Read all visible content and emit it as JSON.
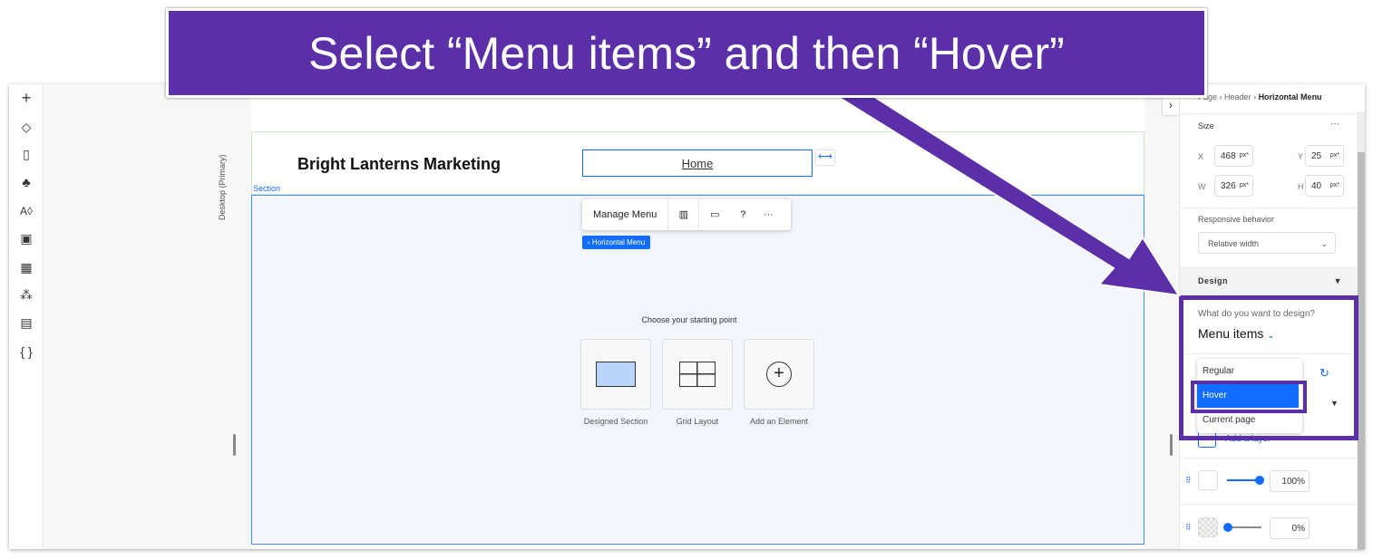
{
  "banner": {
    "text": "Select “Menu items” and then “Hover”"
  },
  "toolbar": {
    "items": [
      "add-icon",
      "layers-icon",
      "pages-icon",
      "apps-icon",
      "theme-icon",
      "media-icon",
      "widgets-icon",
      "components-icon",
      "cms-table-icon",
      "code-icon"
    ]
  },
  "canvas": {
    "device_label": "Desktop (Primary)",
    "site_title": "Bright Lanterns Marketing",
    "menu_item": "Home",
    "section_label": "Section",
    "context_menu": {
      "manage": "Manage Menu"
    },
    "breadcrumb_tag": "‹ Horizontal Menu",
    "starting_point": "Choose your starting point",
    "cards": [
      "Designed Section",
      "Grid Layout",
      "Add an Element"
    ]
  },
  "panel": {
    "breadcrumb": [
      "Page",
      "Header",
      "Horizontal Menu"
    ],
    "size_label": "Size",
    "x": "468",
    "y": "25",
    "w": "326",
    "h": "40",
    "unit": "px*",
    "responsive_label": "Responsive behavior",
    "responsive_value": "Relative width",
    "design_label": "Design",
    "design_question": "What do you want to design?",
    "design_target": "Menu items",
    "states": [
      "Regular",
      "Hover",
      "Current page"
    ],
    "selected_state": "Hover",
    "add_layer": "Add a layer",
    "layer1_opacity": "100",
    "layer2_opacity": "0",
    "pct": "%"
  },
  "colors": {
    "accent": "#116dff",
    "annotation": "#5b2fa8"
  }
}
